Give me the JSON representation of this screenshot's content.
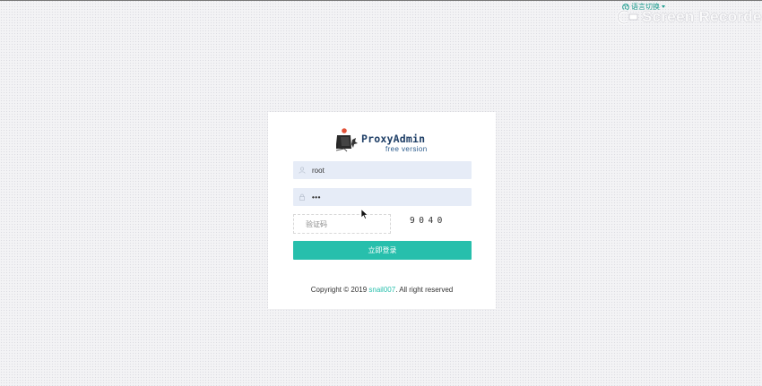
{
  "language_switch": {
    "label": "语言切换",
    "icon": "globe-icon"
  },
  "watermark": {
    "text": "Screen Recorder",
    "icon": "recorder-logo-icon"
  },
  "brand": {
    "title": "ProxyAdmin",
    "subtitle": "free version",
    "icon": "proxyadmin-logo-icon"
  },
  "form": {
    "username": {
      "value": "root",
      "icon": "user-icon"
    },
    "password": {
      "value": "•••",
      "icon": "lock-icon"
    },
    "captcha": {
      "placeholder": "验证码",
      "icon": "check-icon",
      "code": "9040"
    },
    "submit_label": "立即登录"
  },
  "footer": {
    "prefix": "Copyright © 2019 ",
    "author_link": "snail007",
    "suffix": ". All right reserved"
  },
  "colors": {
    "accent": "#27bfac",
    "field_bg": "#e6ecf7",
    "brand_text": "#1e3e66"
  }
}
